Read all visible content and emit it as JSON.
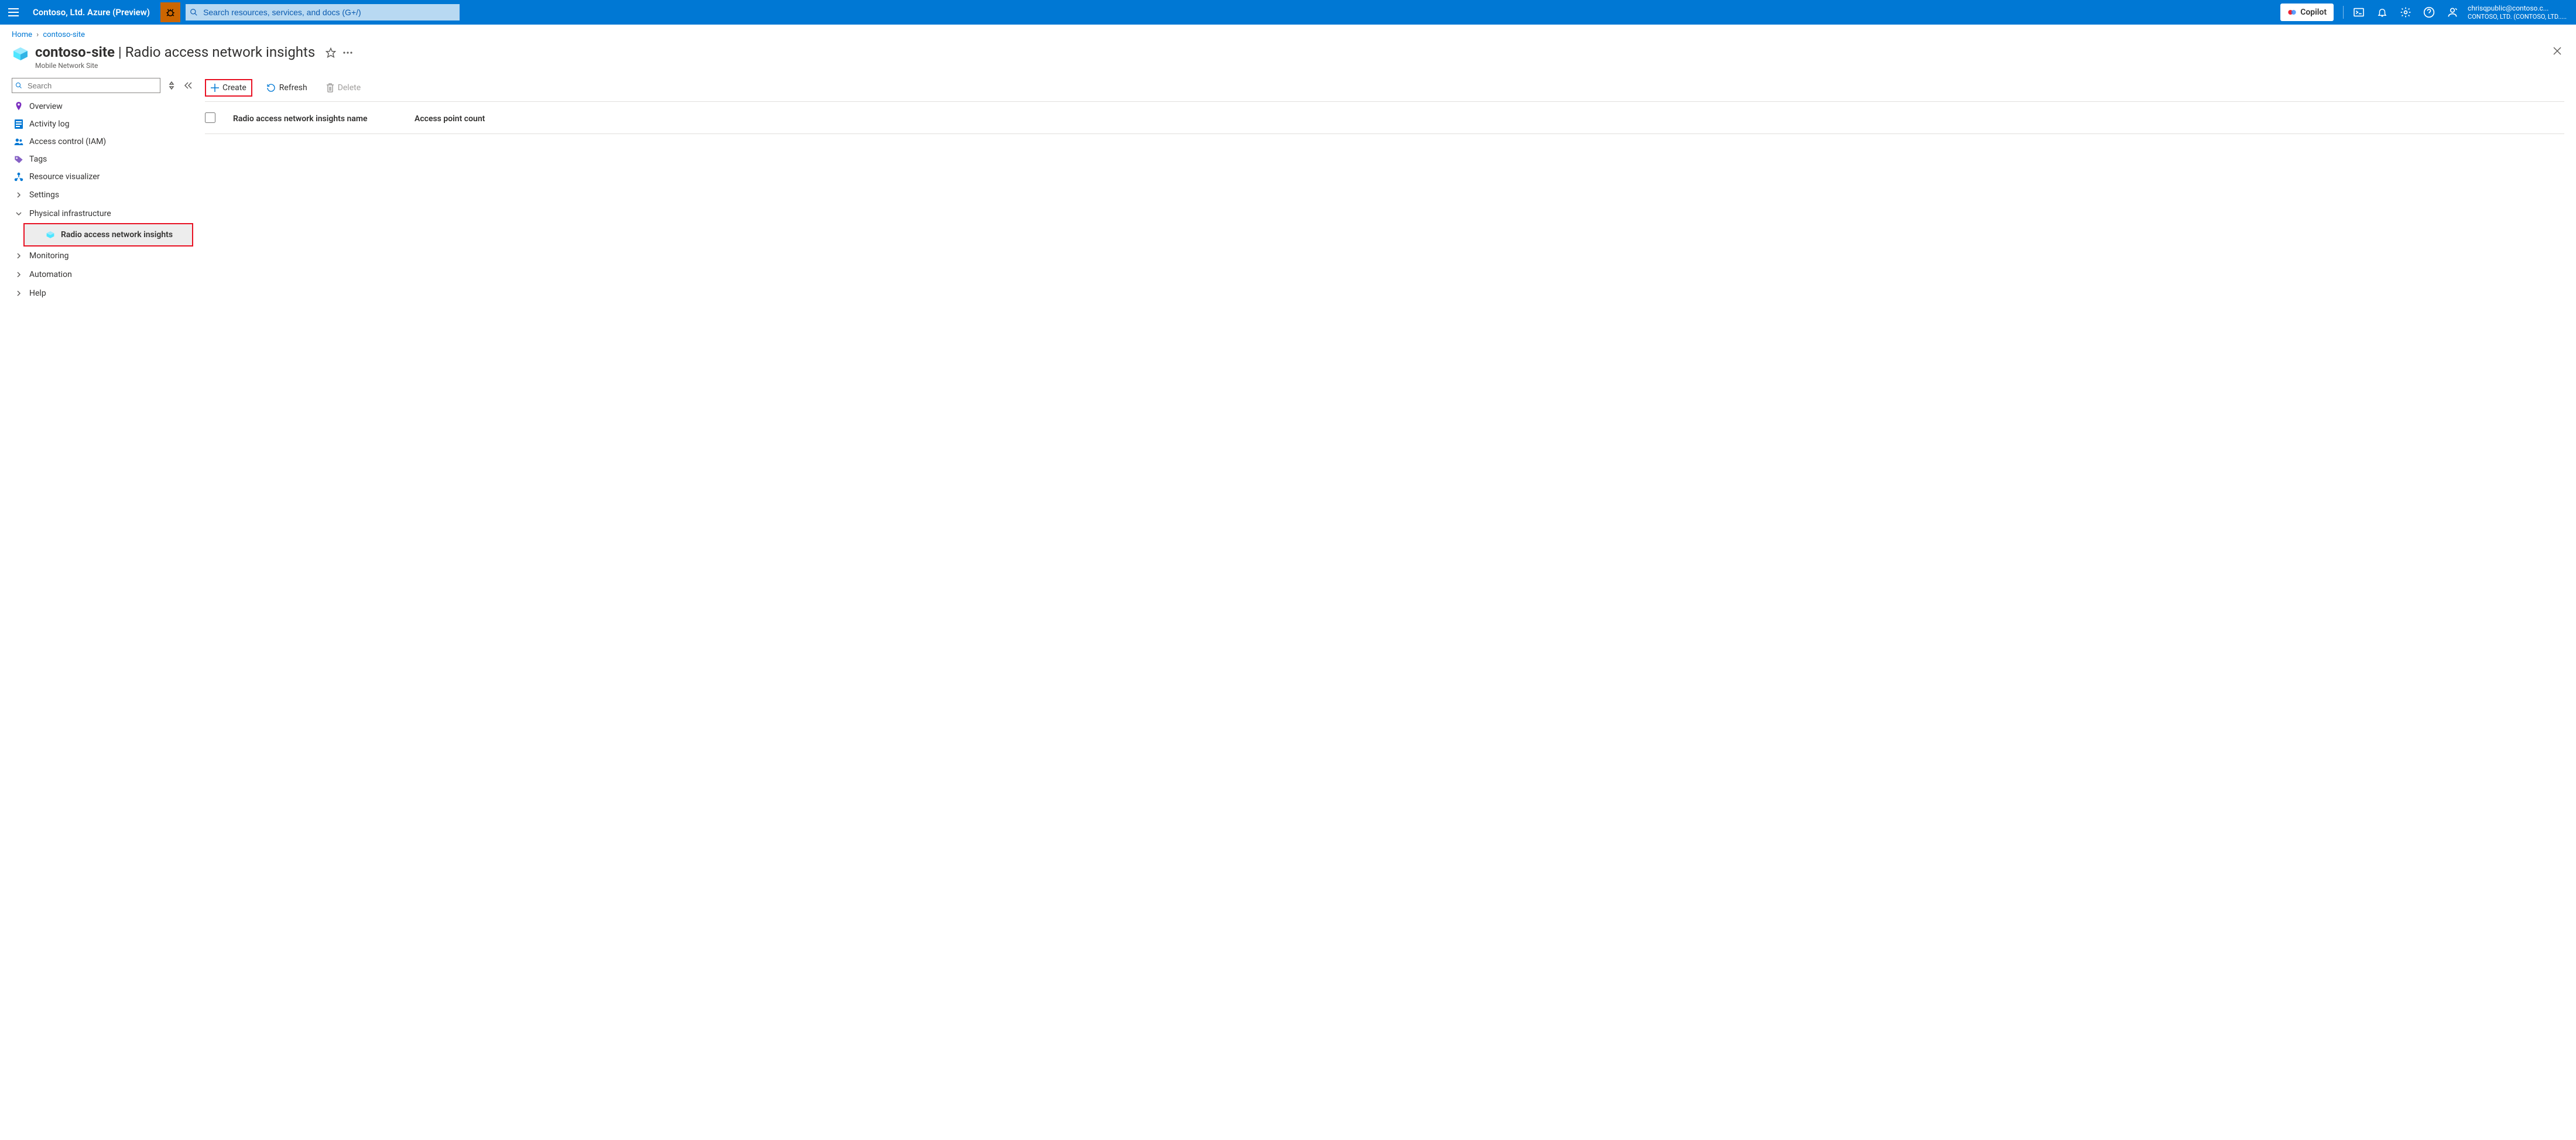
{
  "topbar": {
    "brand": "Contoso, Ltd. Azure (Preview)",
    "search_placeholder": "Search resources, services, and docs (G+/)",
    "copilot_label": "Copilot",
    "account": {
      "email": "chrisqpublic@contoso.c...",
      "tenant": "CONTOSO, LTD. (CONTOSO, LTD....."
    }
  },
  "breadcrumb": {
    "items": [
      "Home",
      "contoso-site"
    ]
  },
  "page": {
    "resource_name": "contoso-site",
    "title_suffix": "Radio access network insights",
    "subtype": "Mobile Network Site"
  },
  "leftnav": {
    "search_placeholder": "Search",
    "items": [
      {
        "label": "Overview",
        "icon": "overview"
      },
      {
        "label": "Activity log",
        "icon": "activitylog"
      },
      {
        "label": "Access control (IAM)",
        "icon": "iam"
      },
      {
        "label": "Tags",
        "icon": "tags"
      },
      {
        "label": "Resource visualizer",
        "icon": "visualizer"
      }
    ],
    "groups": [
      {
        "label": "Settings",
        "expanded": false
      },
      {
        "label": "Physical infrastructure",
        "expanded": true,
        "children": [
          {
            "label": "Radio access network insights",
            "icon": "resource",
            "selected": true,
            "highlighted": true
          }
        ]
      },
      {
        "label": "Monitoring",
        "expanded": false
      },
      {
        "label": "Automation",
        "expanded": false
      },
      {
        "label": "Help",
        "expanded": false
      }
    ]
  },
  "toolbar": {
    "create_label": "Create",
    "refresh_label": "Refresh",
    "delete_label": "Delete"
  },
  "table": {
    "columns": [
      "Radio access network insights name",
      "Access point count"
    ],
    "rows": []
  }
}
